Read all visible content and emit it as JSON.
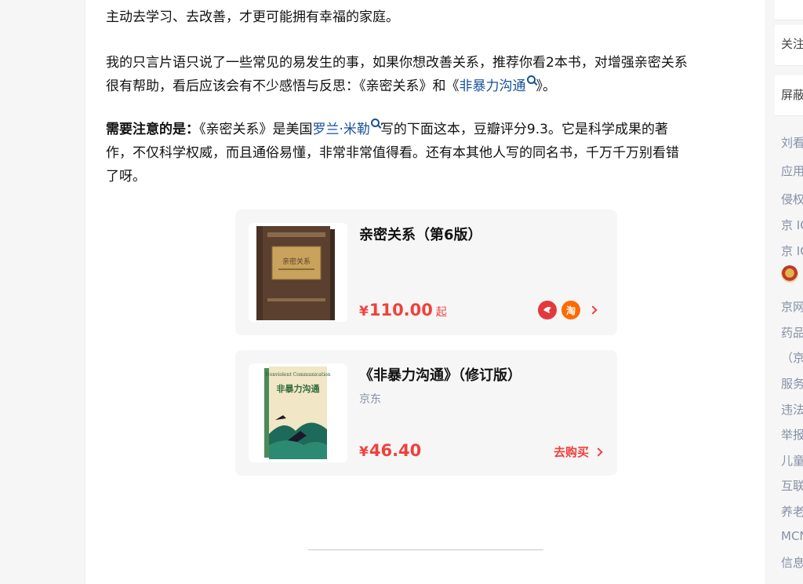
{
  "article": {
    "paragraph_1_fragment": "主动去学习、去改善，才更可能拥有幸福的家庭。",
    "paragraph_2": {
      "line_1": "我的只言片语只说了一些常见的易发生的事，如果你想改善关系，推荐你看2本书，对增强亲密关系",
      "line_2_before": "很有帮助，看后应该会有不少感悟与反思：《亲密关系》和《",
      "link_book": "非暴力沟通",
      "line_2_after": "》。"
    },
    "paragraph_3": {
      "strong": "需要注意的是：",
      "before_link": "《亲密关系》是美国",
      "link_author": "罗兰·米勒",
      "after_link": "写的下面这本，豆瓣评分9.3。它是科学成果的著",
      "line_2": "作，不仅科学权威，而且通俗易懂，非常非常值得看。还有本其他人写的同名书，千万千万别看错",
      "line_3": "了呀。"
    }
  },
  "cards": [
    {
      "title": "亲密关系（第6版）",
      "cover_title": "亲密关系",
      "currency": "¥",
      "price": "110.00",
      "price_suffix": "起",
      "badges": [
        {
          "name": "jd-logo-icon",
          "text": "京东"
        },
        {
          "name": "taobao-logo-icon",
          "text": "淘"
        }
      ]
    },
    {
      "title": "《非暴力沟通》（修订版）",
      "subtitle": "京东",
      "cover_title": "非暴力沟通",
      "cover_en": "Nonviolent Communication",
      "currency": "¥",
      "price": "46.40",
      "buy_label": "去购买"
    }
  ],
  "sidebar": {
    "items": [
      "关注",
      "屏蔽"
    ],
    "links": [
      "刘看",
      "应用",
      "侵权",
      "京 IC",
      "京 IC",
      "京网",
      "药品",
      "（京",
      "服务",
      "违法",
      "举报",
      "儿童",
      "互联",
      "养老",
      "MCN",
      "信息"
    ]
  },
  "colors": {
    "link": "#175199",
    "price": "#f1403c",
    "card_bg": "#f6f6f6"
  }
}
